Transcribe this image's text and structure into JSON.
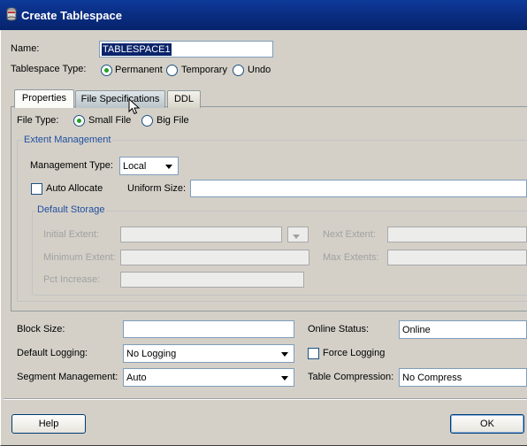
{
  "window": {
    "title": "Create Tablespace"
  },
  "form": {
    "name_label": "Name:",
    "name_value": "TABLESPACE1",
    "type_label": "Tablespace Type:",
    "type_options": [
      "Permanent",
      "Temporary",
      "Undo"
    ],
    "type_selected": "Permanent"
  },
  "tabs": [
    {
      "label": "Properties",
      "active": true
    },
    {
      "label": "File Specifications",
      "active": false
    },
    {
      "label": "DDL",
      "active": false
    }
  ],
  "properties": {
    "file_type_label": "File Type:",
    "file_type_options": [
      "Small File",
      "Big File"
    ],
    "file_type_selected": "Small File",
    "extent_group": "Extent Management",
    "management_type_label": "Management Type:",
    "management_type_value": "Local",
    "auto_allocate_label": "Auto Allocate",
    "auto_allocate_checked": false,
    "uniform_size_label": "Uniform Size:",
    "uniform_size_value": "",
    "storage_group": "Default Storage",
    "initial_extent_label": "Initial Extent:",
    "next_extent_label": "Next Extent:",
    "minimum_extent_label": "Minimum Extent:",
    "max_extents_label": "Max Extents:",
    "pct_increase_label": "Pct Increase:",
    "block_size_label": "Block Size:",
    "block_size_value": "",
    "online_status_label": "Online Status:",
    "online_status_value": "Online",
    "default_logging_label": "Default Logging:",
    "default_logging_value": "No Logging",
    "force_logging_label": "Force Logging",
    "force_logging_checked": false,
    "segment_management_label": "Segment Management:",
    "segment_management_value": "Auto",
    "table_compression_label": "Table Compression:",
    "table_compression_value": "No Compress"
  },
  "buttons": {
    "help": "Help",
    "ok": "OK"
  }
}
